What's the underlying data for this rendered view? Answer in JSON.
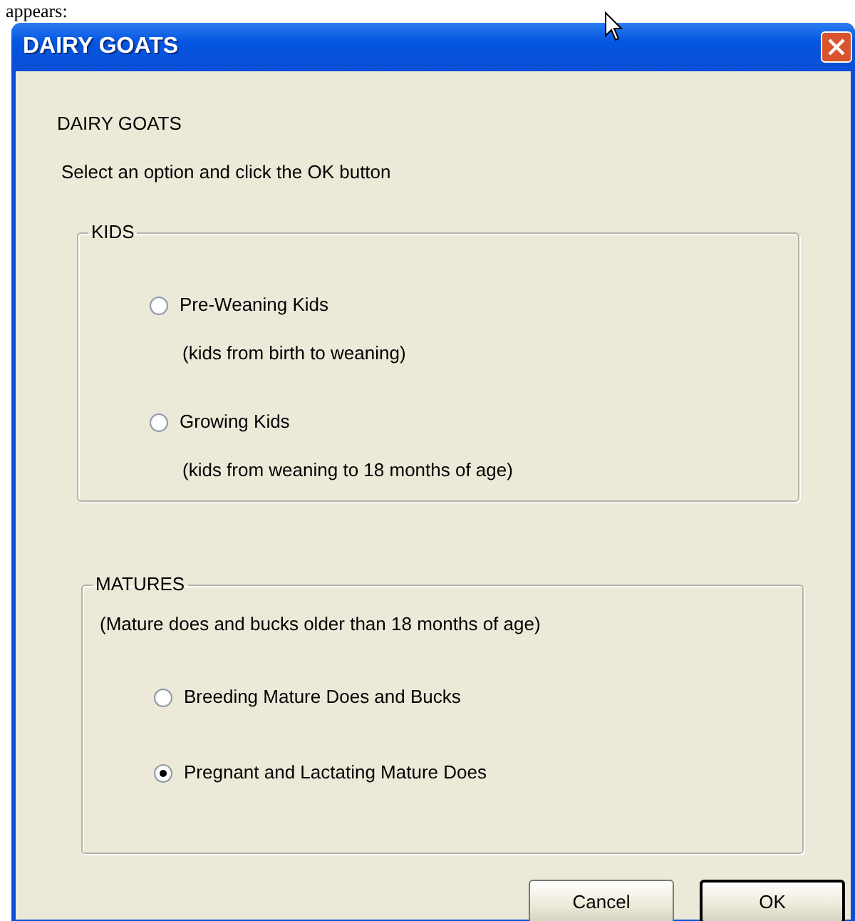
{
  "background_text": "appears:",
  "window": {
    "title": "DAIRY GOATS"
  },
  "heading": "DAIRY GOATS",
  "instruction": "Select an option and click the OK button",
  "groups": [
    {
      "title": "KIDS",
      "options": [
        {
          "label": "Pre-Weaning Kids",
          "detail": "(kids from birth to weaning)",
          "selected": false
        },
        {
          "label": "Growing Kids",
          "detail": "(kids from weaning to 18 months of age)",
          "selected": false
        }
      ]
    },
    {
      "title": "MATURES",
      "description": "(Mature does and bucks older than 18 months of age)",
      "options": [
        {
          "label": "Breeding Mature Does and Bucks",
          "selected": false
        },
        {
          "label": "Pregnant and Lactating Mature Does",
          "selected": true
        }
      ]
    }
  ],
  "buttons": [
    {
      "label": "Cancel",
      "default": false
    },
    {
      "label": "OK",
      "default": true
    }
  ]
}
